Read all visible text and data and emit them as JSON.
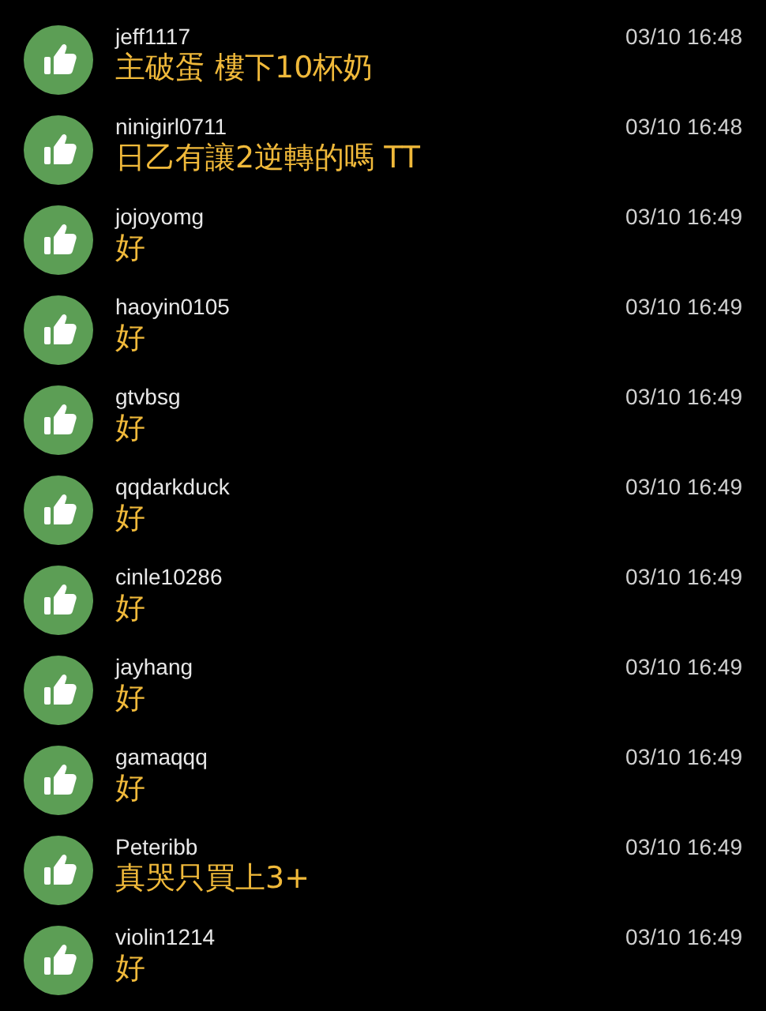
{
  "comments": [
    {
      "user": "jeff1117",
      "time": "03/10 16:48",
      "text": "主破蛋 樓下10杯奶"
    },
    {
      "user": "ninigirl0711",
      "time": "03/10 16:48",
      "text": "日乙有讓2逆轉的嗎 TT"
    },
    {
      "user": "jojoyomg",
      "time": "03/10 16:49",
      "text": "好"
    },
    {
      "user": "haoyin0105",
      "time": "03/10 16:49",
      "text": "好"
    },
    {
      "user": "gtvbsg",
      "time": "03/10 16:49",
      "text": "好"
    },
    {
      "user": "qqdarkduck",
      "time": "03/10 16:49",
      "text": "好"
    },
    {
      "user": "cinle10286",
      "time": "03/10 16:49",
      "text": "好"
    },
    {
      "user": "jayhang",
      "time": "03/10 16:49",
      "text": "好"
    },
    {
      "user": "gamaqqq",
      "time": "03/10 16:49",
      "text": "好"
    },
    {
      "user": "Peteribb",
      "time": "03/10 16:49",
      "text": "真哭只買上3+"
    },
    {
      "user": "violin1214",
      "time": "03/10 16:49",
      "text": "好"
    }
  ]
}
